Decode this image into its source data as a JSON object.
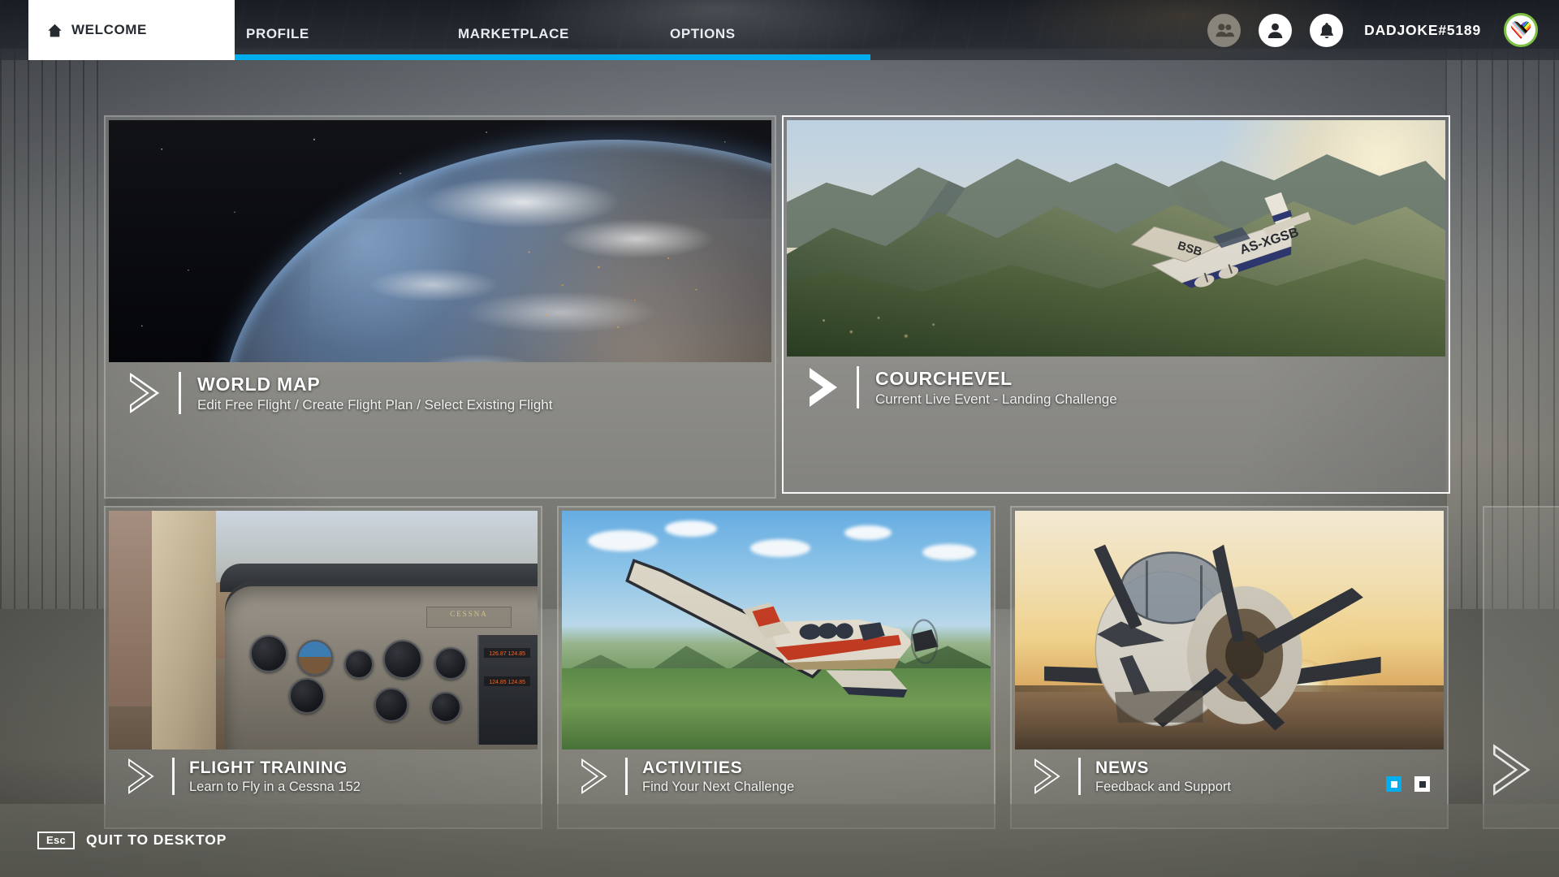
{
  "nav": {
    "home_tab": {
      "label": "WELCOME",
      "icon": "home-icon",
      "active": true
    },
    "tabs": [
      {
        "label": "PROFILE"
      },
      {
        "label": "MARKETPLACE"
      },
      {
        "label": "OPTIONS"
      }
    ],
    "accent_color": "#00aeef",
    "icons": [
      {
        "name": "friends-icon",
        "state": "dim"
      },
      {
        "name": "profile-icon",
        "state": "lit"
      },
      {
        "name": "notifications-bell-icon",
        "state": "lit"
      }
    ],
    "gamertag": "DADJOKE#5189",
    "avatar": {
      "name": "avatar",
      "ring_color": "#7dc242",
      "art": "pride-heart"
    }
  },
  "tiles": {
    "world_map": {
      "title": "WORLD MAP",
      "subtitle": "Edit Free Flight / Create Flight Plan / Select Existing Flight",
      "art": "earth-from-space",
      "selected": false
    },
    "courchevel": {
      "title": "COURCHEVEL",
      "subtitle": "Current Live Event - Landing Challenge",
      "art": "light-aircraft-over-alps",
      "aircraft_registration": "AS-XGSB",
      "selected": true
    },
    "flight_training": {
      "title": "FLIGHT TRAINING",
      "subtitle": "Learn to Fly in a Cessna 152",
      "art": "cessna-cockpit",
      "panel_brand": "CESSNA",
      "selected": false
    },
    "activities": {
      "title": "ACTIVITIES",
      "subtitle": "Find Your Next Challenge",
      "art": "turboprop-over-green-mountains",
      "selected": false
    },
    "news": {
      "title": "NEWS",
      "subtitle": "Feedback and Support",
      "art": "turboprop-at-sunset",
      "selected": false,
      "pagination": [
        {
          "state": "active",
          "color": "#00aeef"
        },
        {
          "state": "inactive",
          "color": "#ffffff"
        }
      ]
    }
  },
  "carousel": {
    "next_arrow": "chevron-right-icon"
  },
  "footer": {
    "quit": {
      "key": "Esc",
      "label": "QUIT TO DESKTOP"
    }
  }
}
